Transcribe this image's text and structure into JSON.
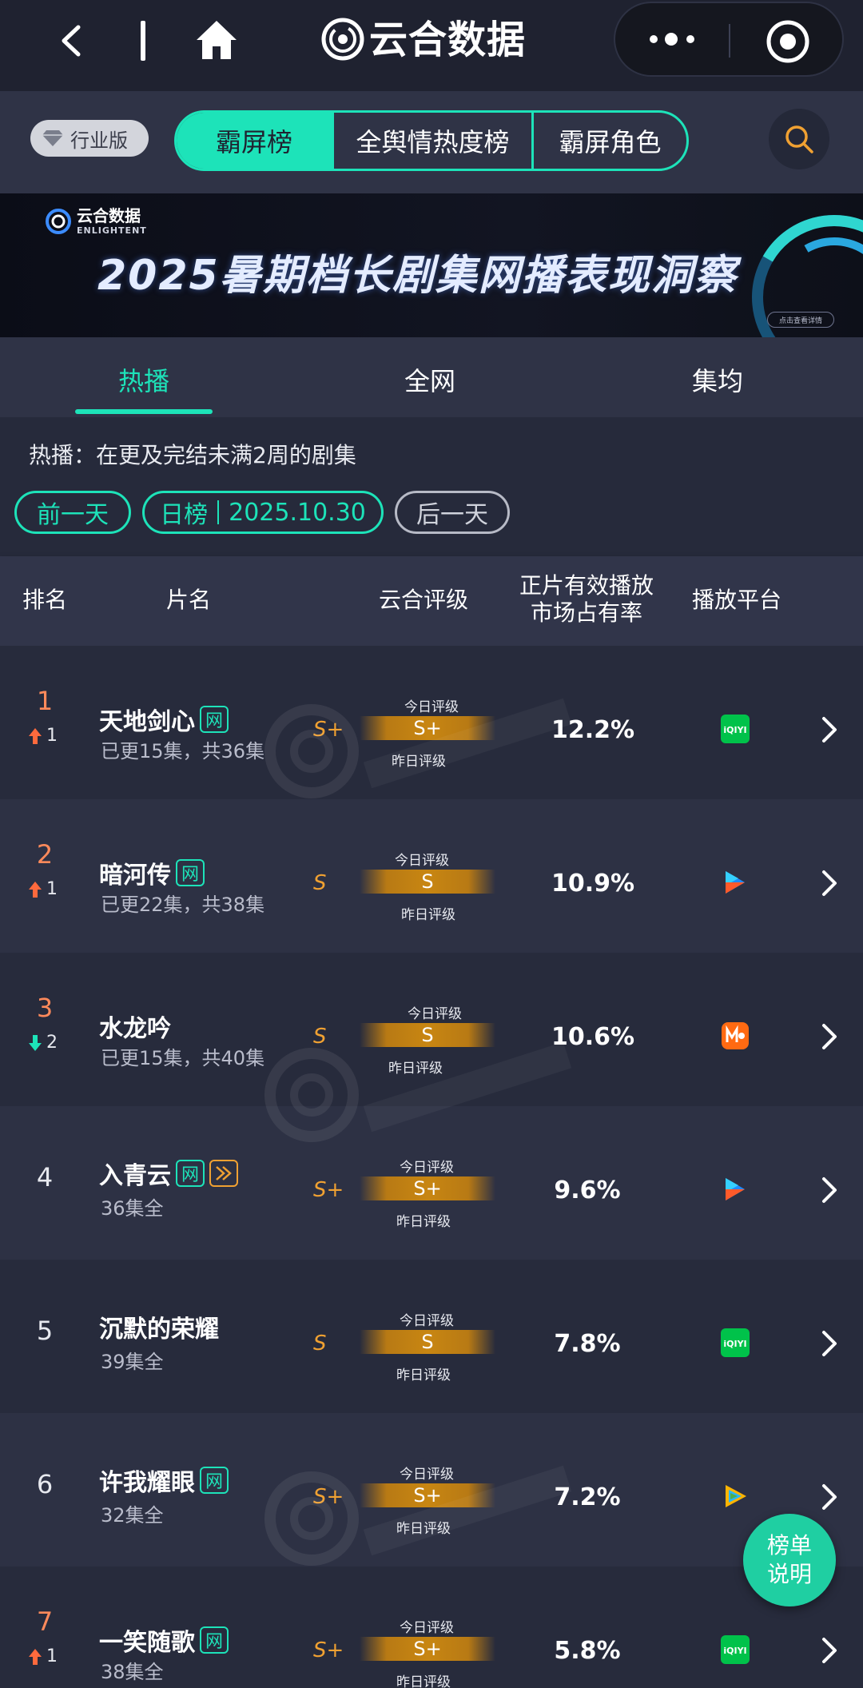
{
  "app": {
    "title": "云合数据"
  },
  "header": {
    "badge_label": "行业版",
    "segments": [
      "霸屏榜",
      "全舆情热度榜",
      "霸屏角色"
    ],
    "active_segment": 0
  },
  "banner": {
    "logo_cn": "云合数据",
    "logo_en": "ENLIGHTENT",
    "title": "2025暑期档长剧集网播表现洞察",
    "cta": "点击查看详情"
  },
  "tabs": [
    "热播",
    "全网",
    "集均"
  ],
  "filter": {
    "description": "热播：在更及完结未满2周的剧集",
    "prev_label": "前一天",
    "date_kind": "日榜",
    "date": "2025.10.30",
    "next_label": "后一天"
  },
  "table": {
    "headers": {
      "rank": "排名",
      "title": "片名",
      "grade": "云合评级",
      "share_line1": "正片有效播放",
      "share_line2": "市场占有率",
      "platform": "播放平台"
    },
    "today_label": "今日评级",
    "yesterday_label": "昨日评级",
    "rows": [
      {
        "rank": "1",
        "change": "1",
        "change_dir": "up",
        "title": "天地剑心",
        "tags": [
          "网"
        ],
        "subtitle": "已更15集，共36集",
        "grade": "S+",
        "grade_mid": "S+",
        "share": "12.2%",
        "platform": "iqiyi-icon"
      },
      {
        "rank": "2",
        "change": "1",
        "change_dir": "up",
        "title": "暗河传",
        "tags": [
          "网"
        ],
        "subtitle": "已更22集，共38集",
        "grade": "S",
        "grade_mid": "S",
        "share": "10.9%",
        "platform": "youku-icon"
      },
      {
        "rank": "3",
        "change": "2",
        "change_dir": "down",
        "title": "水龙吟",
        "tags": [],
        "subtitle": "已更15集，共40集",
        "grade": "S",
        "grade_mid": "S",
        "share": "10.6%",
        "platform": "mango-icon"
      },
      {
        "rank": "4",
        "change": "",
        "change_dir": "",
        "title": "入青云",
        "tags": [
          "网",
          "play"
        ],
        "subtitle": "36集全",
        "grade": "S+",
        "grade_mid": "S+",
        "share": "9.6%",
        "platform": "youku-icon"
      },
      {
        "rank": "5",
        "change": "",
        "change_dir": "",
        "title": "沉默的荣耀",
        "tags": [],
        "subtitle": "39集全",
        "grade": "S",
        "grade_mid": "S",
        "share": "7.8%",
        "platform": "iqiyi-icon"
      },
      {
        "rank": "6",
        "change": "",
        "change_dir": "",
        "title": "许我耀眼",
        "tags": [
          "网"
        ],
        "subtitle": "32集全",
        "grade": "S+",
        "grade_mid": "S+",
        "share": "7.2%",
        "platform": "tencent-video-icon"
      },
      {
        "rank": "7",
        "change": "1",
        "change_dir": "up",
        "title": "一笑随歌",
        "tags": [
          "网"
        ],
        "subtitle": "38集全",
        "grade": "S+",
        "grade_mid": "S+",
        "share": "5.8%",
        "platform": "iqiyi-icon"
      }
    ]
  },
  "help_button": {
    "line1": "榜单",
    "line2": "说明"
  },
  "colors": {
    "accent": "#1de3b9",
    "rank_top": "#ff8a5b",
    "grade": "#f0a132",
    "up": "#ff6a3d",
    "down": "#1de3b9"
  }
}
